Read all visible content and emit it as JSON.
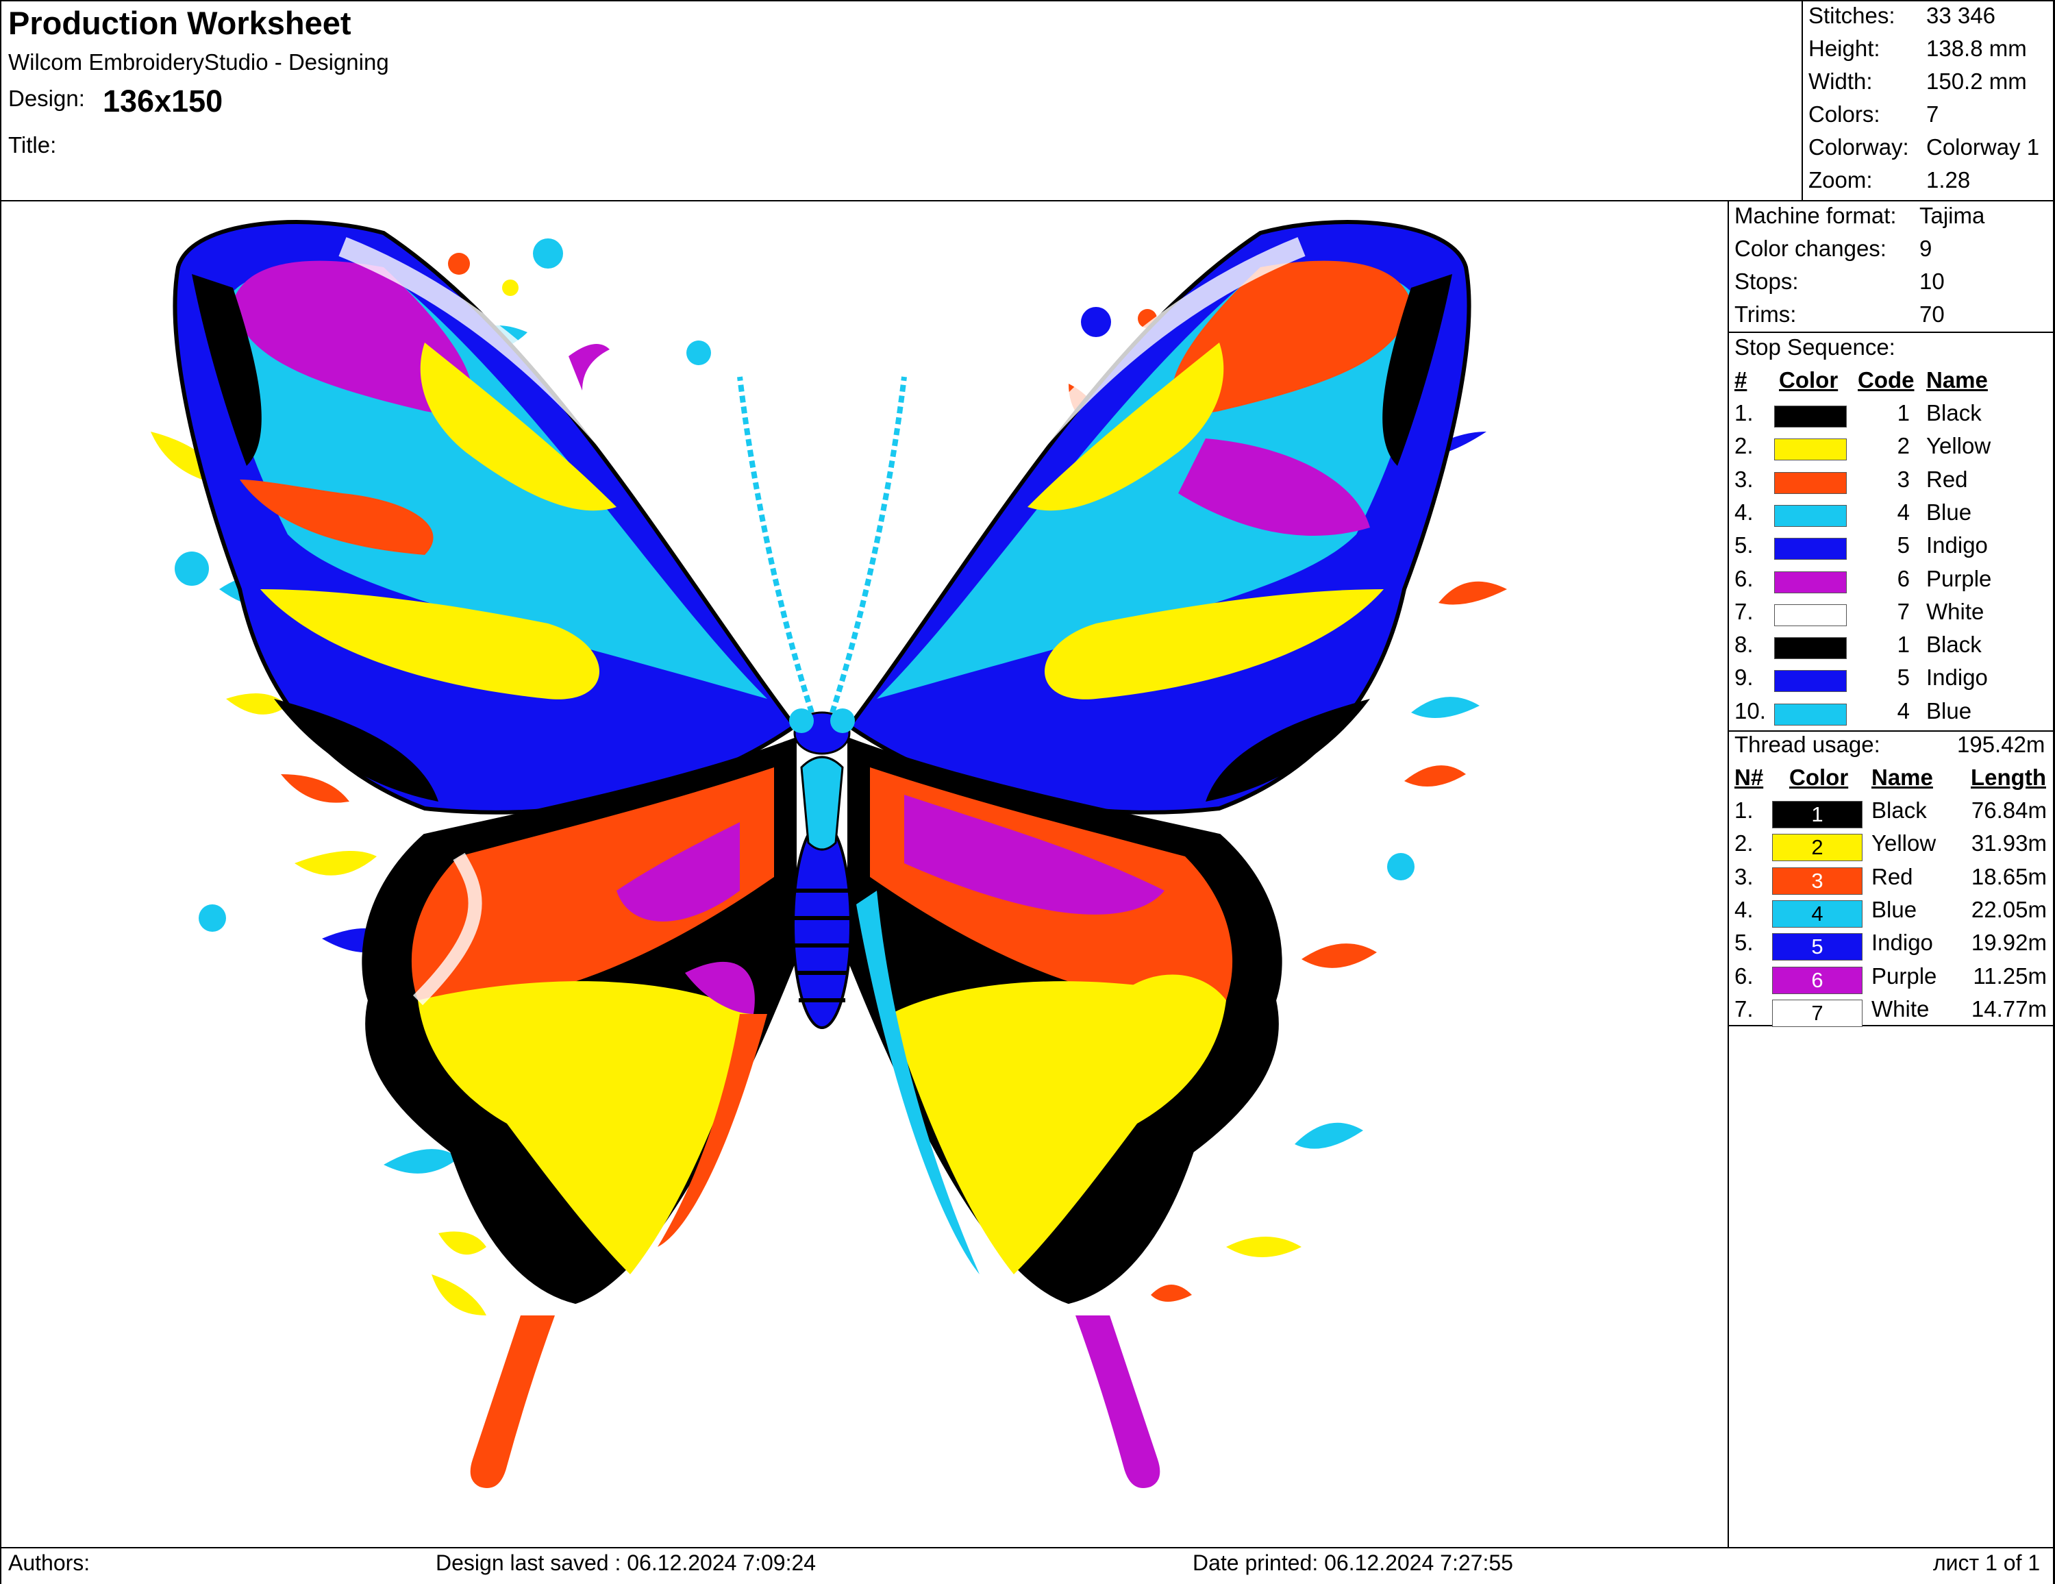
{
  "header": {
    "title": "Production Worksheet",
    "app": "Wilcom EmbroideryStudio - Designing",
    "design_label": "Design:",
    "design_value": "136x150",
    "title_label": "Title:"
  },
  "summary": [
    {
      "label": "Stitches:",
      "value": "33 346"
    },
    {
      "label": "Height:",
      "value": "138.8 mm"
    },
    {
      "label": "Width:",
      "value": "150.2 mm"
    },
    {
      "label": "Colors:",
      "value": "7"
    },
    {
      "label": "Colorway:",
      "value": "Colorway 1"
    },
    {
      "label": "Zoom:",
      "value": "1.28"
    }
  ],
  "machine": [
    {
      "label": "Machine format:",
      "value": "Tajima"
    },
    {
      "label": "Color changes:",
      "value": "9"
    },
    {
      "label": "Stops:",
      "value": "10"
    },
    {
      "label": "Trims:",
      "value": "70"
    }
  ],
  "stop_sequence": {
    "title": "Stop Sequence:",
    "headers": {
      "num": "#",
      "color": "Color",
      "code": "Code",
      "name": "Name"
    },
    "rows": [
      {
        "num": "1.",
        "color": "#000000",
        "code": "1",
        "name": "Black"
      },
      {
        "num": "2.",
        "color": "#FFF200",
        "code": "2",
        "name": "Yellow"
      },
      {
        "num": "3.",
        "color": "#FF4A0A",
        "code": "3",
        "name": "Red"
      },
      {
        "num": "4.",
        "color": "#19C8F0",
        "code": "4",
        "name": "Blue"
      },
      {
        "num": "5.",
        "color": "#1010F0",
        "code": "5",
        "name": "Indigo"
      },
      {
        "num": "6.",
        "color": "#C010D0",
        "code": "6",
        "name": "Purple"
      },
      {
        "num": "7.",
        "color": "#FFFFFF",
        "code": "7",
        "name": "White"
      },
      {
        "num": "8.",
        "color": "#000000",
        "code": "1",
        "name": "Black"
      },
      {
        "num": "9.",
        "color": "#1010F0",
        "code": "5",
        "name": "Indigo"
      },
      {
        "num": "10.",
        "color": "#19C8F0",
        "code": "4",
        "name": "Blue"
      }
    ]
  },
  "thread_usage": {
    "title": "Thread usage:",
    "total": "195.42m",
    "headers": {
      "num": "N#",
      "color": "Color",
      "name": "Name",
      "length": "Length"
    },
    "rows": [
      {
        "num": "1.",
        "color": "#000000",
        "text_color": "#FFFFFF",
        "code": "1",
        "name": "Black",
        "length": "76.84m"
      },
      {
        "num": "2.",
        "color": "#FFF200",
        "text_color": "#000000",
        "code": "2",
        "name": "Yellow",
        "length": "31.93m"
      },
      {
        "num": "3.",
        "color": "#FF4A0A",
        "text_color": "#FFFFFF",
        "code": "3",
        "name": "Red",
        "length": "18.65m"
      },
      {
        "num": "4.",
        "color": "#19C8F0",
        "text_color": "#000000",
        "code": "4",
        "name": "Blue",
        "length": "22.05m"
      },
      {
        "num": "5.",
        "color": "#1010F0",
        "text_color": "#FFFFFF",
        "code": "5",
        "name": "Indigo",
        "length": "19.92m"
      },
      {
        "num": "6.",
        "color": "#C010D0",
        "text_color": "#FFFFFF",
        "code": "6",
        "name": "Purple",
        "length": "11.25m"
      },
      {
        "num": "7.",
        "color": "#FFFFFF",
        "text_color": "#000000",
        "code": "7",
        "name": "White",
        "length": "14.77m"
      }
    ]
  },
  "footer": {
    "authors": "Authors:",
    "last_saved": "Design last saved : 06.12.2024 7:09:24",
    "printed": "Date printed: 06.12.2024 7:27:55",
    "page": "лист 1 of 1"
  },
  "design_preview": {
    "description_icon": "butterfly-embroidery-icon",
    "colors": {
      "black": "#000000",
      "yellow": "#FFF200",
      "red": "#FF4A0A",
      "blue": "#19C8F0",
      "indigo": "#1010F0",
      "purple": "#C010D0",
      "white": "#FFFFFF"
    }
  }
}
